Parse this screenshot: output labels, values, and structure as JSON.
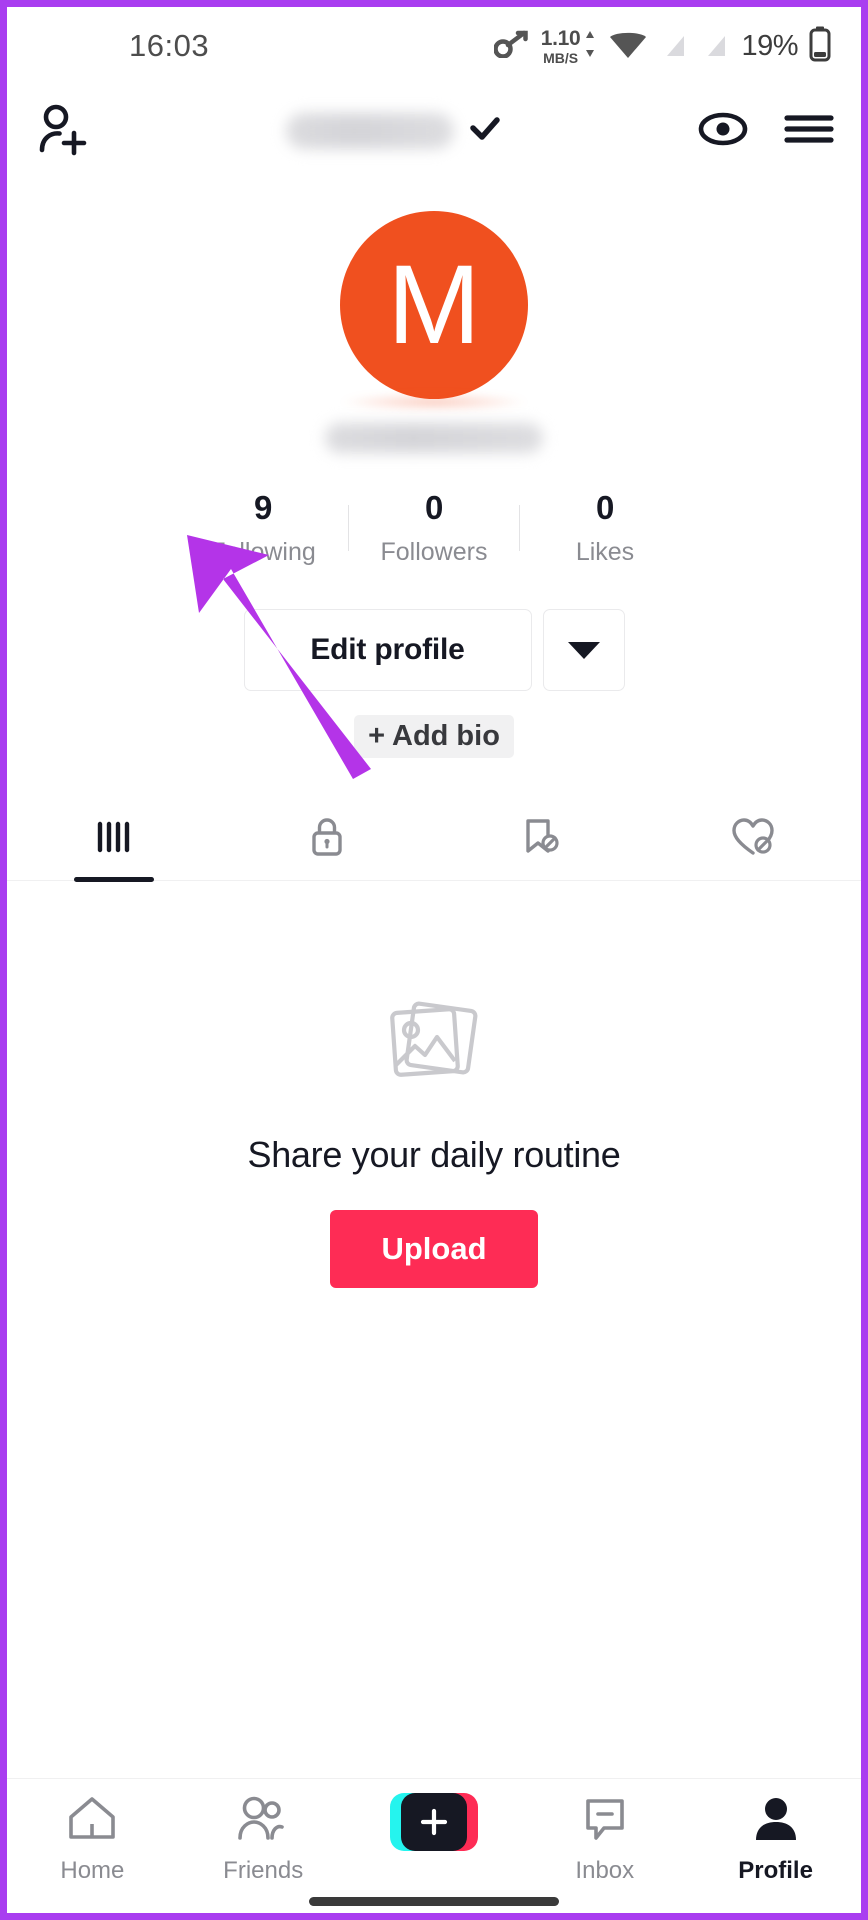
{
  "statusbar": {
    "time": "16:03",
    "net_speed_value": "1.10",
    "net_speed_unit": "MB/S",
    "battery_percent": "19%",
    "icons": [
      "vpn-key-icon",
      "data-transfer-icon",
      "wifi-icon",
      "sim-1-no-signal-icon",
      "sim-2-no-signal-icon",
      "battery-icon"
    ]
  },
  "header": {
    "add_friends_icon": "person-add-icon",
    "username_masked": "",
    "dropdown_icon": "check-icon",
    "views_icon": "eye-icon",
    "menu_icon": "hamburger-menu-icon"
  },
  "profile": {
    "avatar_letter": "M",
    "avatar_color": "#f0501f",
    "handle_masked": "",
    "stats": [
      {
        "value": "9",
        "label": "Following"
      },
      {
        "value": "0",
        "label": "Followers"
      },
      {
        "value": "0",
        "label": "Likes"
      }
    ],
    "edit_profile_label": "Edit profile",
    "dropdown_caret_icon": "chevron-down-icon",
    "add_bio_label": "+ Add bio"
  },
  "tabs": [
    {
      "name": "posts",
      "icon": "grid-posts-icon",
      "active": true
    },
    {
      "name": "private",
      "icon": "lock-icon",
      "active": false
    },
    {
      "name": "saved",
      "icon": "bookmark-hidden-icon",
      "active": false
    },
    {
      "name": "liked",
      "icon": "heart-hidden-icon",
      "active": false
    }
  ],
  "empty_state": {
    "icon": "photo-stack-icon",
    "title": "Share your daily routine",
    "button_label": "Upload",
    "button_color": "#fe2c55"
  },
  "bottom_nav": {
    "items": [
      {
        "label": "Home",
        "icon": "home-icon",
        "active": false
      },
      {
        "label": "Friends",
        "icon": "friends-icon",
        "active": false
      },
      {
        "label": "",
        "icon": "create-plus-icon",
        "active": false
      },
      {
        "label": "Inbox",
        "icon": "inbox-message-icon",
        "active": false
      },
      {
        "label": "Profile",
        "icon": "person-filled-icon",
        "active": true
      }
    ]
  },
  "annotation": {
    "arrow_color": "#b434e8",
    "points_at": "Following"
  }
}
